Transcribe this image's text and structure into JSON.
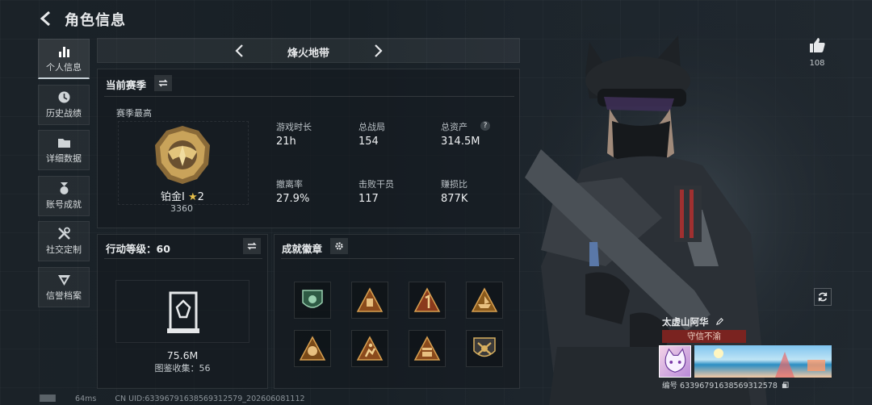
{
  "header": {
    "title": "角色信息"
  },
  "nav": [
    {
      "label": "个人信息",
      "icon": "bar-chart-icon"
    },
    {
      "label": "历史战绩",
      "icon": "clock-icon"
    },
    {
      "label": "详细数据",
      "icon": "folder-icon"
    },
    {
      "label": "账号成就",
      "icon": "medal-icon"
    },
    {
      "label": "社交定制",
      "icon": "tools-icon"
    },
    {
      "label": "信誉档案",
      "icon": "shield-icon"
    }
  ],
  "map": {
    "name": "烽火地带"
  },
  "season": {
    "title": "当前赛季",
    "peak_label": "赛季最高",
    "rank_name": "铂金Ⅰ",
    "rank_stars": "2",
    "rank_score": "3360",
    "stats": [
      {
        "label": "游戏时长",
        "value": "21h"
      },
      {
        "label": "总战局",
        "value": "154"
      },
      {
        "label": "总资产",
        "value": "314.5M"
      },
      {
        "label": "撤离率",
        "value": "27.9%"
      },
      {
        "label": "击败干员",
        "value": "117"
      },
      {
        "label": "赚损比",
        "value": "877K"
      }
    ],
    "help": "?"
  },
  "action": {
    "title": "行动等级：60",
    "value": "75.6M",
    "collection": "图鉴收集：56"
  },
  "achievements": {
    "title": "成就徽章",
    "badges": [
      "shield-badge-icon",
      "triangle-badge-icon",
      "number-one-badge-icon",
      "boat-badge-icon",
      "fifty-badge-icon",
      "runner-badge-icon",
      "crate-badge-icon",
      "crest-badge-icon"
    ]
  },
  "profile": {
    "likes": "108",
    "name": "太虚山阿华",
    "motto": "守信不渝",
    "uid": "编号 63396791638569312578"
  },
  "footer": {
    "ping": "64ms",
    "cn_uid": "CN UID:63396791638569312579_202606081112"
  },
  "colors": {
    "accent": "#c8d2d8",
    "motto_bg": "#7a2320",
    "gold": "#c9a35a"
  }
}
